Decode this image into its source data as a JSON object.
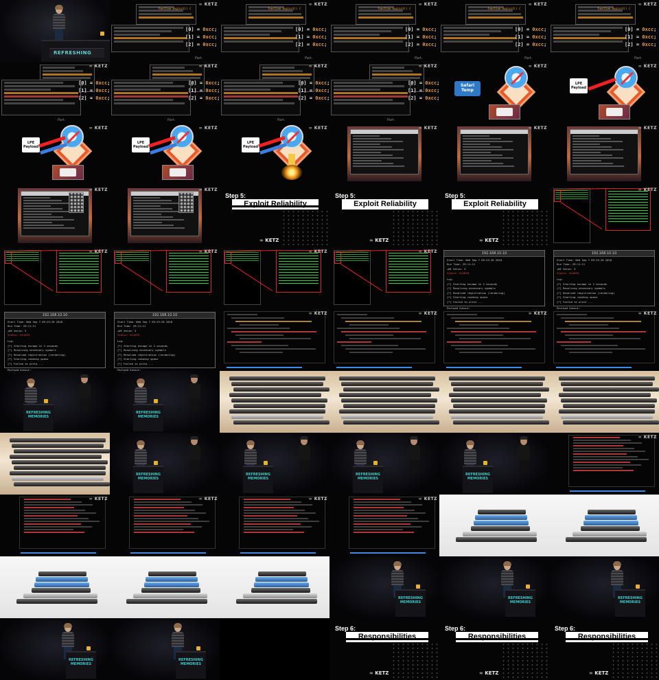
{
  "sheet": {
    "tile_count": 66,
    "columns": 6,
    "rows": 11
  },
  "labels": {
    "refreshing": "REFRESHING",
    "podium_line1": "REFRESHING",
    "podium_line2": "MEMORIES",
    "code_part": "Part.",
    "safari_temp": "Safari\nTemp",
    "lpe_payload": "LPE\nPayload",
    "step5": "Step 5:",
    "step5_title": "Exploit Reliability",
    "step6": "Step 6:",
    "step6_title": "Responsibilities",
    "ketz": "KETZ",
    "browser_ip": "192.168.10.10",
    "browser_lines": [
      "Start Time: Wed Sep 7 09:23:28 2018",
      "Run Time: 29:11:11",
      "+WI Value: 5",
      "Status: 0x10T0",
      "Log:",
      "[*] Starting escape in 2 seconds",
      "[*] Resolving necessary symbols",
      "[*] Resolved registration (rendering)",
      "[*] Starting reading space",
      "[*] Failed to write ...",
      "Payload Output:"
    ],
    "code_lines": [
      "shellcode[0] = 0xcc;",
      "shellcode[1] = 0xcc;",
      "shellcode[2] = 0xcc;"
    ],
    "code_fn": "function exploit() {",
    "code_sc": "shellcode = new Uint8Array(0x100);",
    "code_writing": "log('Writing shellcode over jit page');",
    "code_calling": "log('Calling jit function');"
  },
  "colors": {
    "accent_cyan": "#3cc8c8",
    "code_orange": "#e8a030",
    "spray_green": "#3ac43a",
    "alert_red": "#e22222",
    "link_blue": "#3a8ee8"
  }
}
